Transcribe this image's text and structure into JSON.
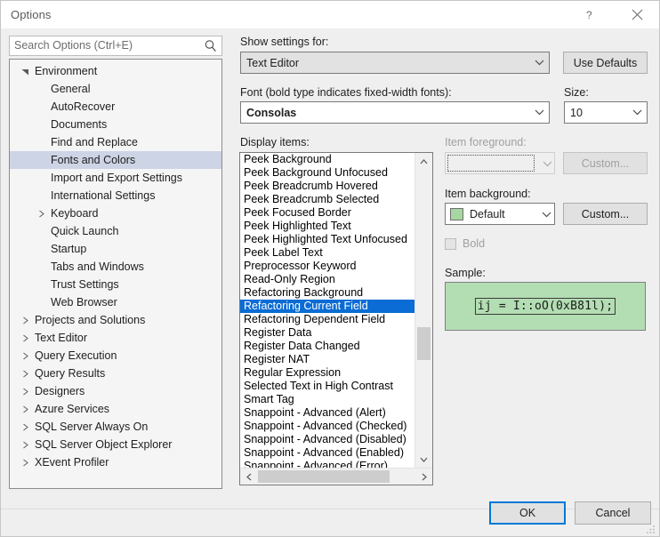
{
  "window": {
    "title": "Options",
    "help_icon": "question-mark-icon",
    "close_icon": "close-icon"
  },
  "search": {
    "placeholder": "Search Options (Ctrl+E)",
    "value": "",
    "icon": "search-icon"
  },
  "tree": {
    "items": [
      {
        "label": "Environment",
        "depth": 0,
        "glyph": "expanded",
        "selected": false
      },
      {
        "label": "General",
        "depth": 1,
        "glyph": "none",
        "selected": false
      },
      {
        "label": "AutoRecover",
        "depth": 1,
        "glyph": "none",
        "selected": false
      },
      {
        "label": "Documents",
        "depth": 1,
        "glyph": "none",
        "selected": false
      },
      {
        "label": "Find and Replace",
        "depth": 1,
        "glyph": "none",
        "selected": false
      },
      {
        "label": "Fonts and Colors",
        "depth": 1,
        "glyph": "none",
        "selected": true
      },
      {
        "label": "Import and Export Settings",
        "depth": 1,
        "glyph": "none",
        "selected": false
      },
      {
        "label": "International Settings",
        "depth": 1,
        "glyph": "none",
        "selected": false
      },
      {
        "label": "Keyboard",
        "depth": 1,
        "glyph": "collapsed",
        "selected": false
      },
      {
        "label": "Quick Launch",
        "depth": 1,
        "glyph": "none",
        "selected": false
      },
      {
        "label": "Startup",
        "depth": 1,
        "glyph": "none",
        "selected": false
      },
      {
        "label": "Tabs and Windows",
        "depth": 1,
        "glyph": "none",
        "selected": false
      },
      {
        "label": "Trust Settings",
        "depth": 1,
        "glyph": "none",
        "selected": false
      },
      {
        "label": "Web Browser",
        "depth": 1,
        "glyph": "none",
        "selected": false
      },
      {
        "label": "Projects and Solutions",
        "depth": 0,
        "glyph": "collapsed",
        "selected": false
      },
      {
        "label": "Text Editor",
        "depth": 0,
        "glyph": "collapsed",
        "selected": false
      },
      {
        "label": "Query Execution",
        "depth": 0,
        "glyph": "collapsed",
        "selected": false
      },
      {
        "label": "Query Results",
        "depth": 0,
        "glyph": "collapsed",
        "selected": false
      },
      {
        "label": "Designers",
        "depth": 0,
        "glyph": "collapsed",
        "selected": false
      },
      {
        "label": "Azure Services",
        "depth": 0,
        "glyph": "collapsed",
        "selected": false
      },
      {
        "label": "SQL Server Always On",
        "depth": 0,
        "glyph": "collapsed",
        "selected": false
      },
      {
        "label": "SQL Server Object Explorer",
        "depth": 0,
        "glyph": "collapsed",
        "selected": false
      },
      {
        "label": "XEvent Profiler",
        "depth": 0,
        "glyph": "collapsed",
        "selected": false
      }
    ]
  },
  "pane": {
    "show_settings_label": "Show settings for:",
    "show_settings_value": "Text Editor",
    "use_defaults_label": "Use Defaults",
    "font_label": "Font (bold type indicates fixed-width fonts):",
    "font_value": "Consolas",
    "size_label": "Size:",
    "size_value": "10",
    "display_items_label": "Display items:",
    "display_items": [
      {
        "label": "Peek Background",
        "selected": false
      },
      {
        "label": "Peek Background Unfocused",
        "selected": false
      },
      {
        "label": "Peek Breadcrumb Hovered",
        "selected": false
      },
      {
        "label": "Peek Breadcrumb Selected",
        "selected": false
      },
      {
        "label": "Peek Focused Border",
        "selected": false
      },
      {
        "label": "Peek Highlighted Text",
        "selected": false
      },
      {
        "label": "Peek Highlighted Text Unfocused",
        "selected": false
      },
      {
        "label": "Peek Label Text",
        "selected": false
      },
      {
        "label": "Preprocessor Keyword",
        "selected": false
      },
      {
        "label": "Read-Only Region",
        "selected": false
      },
      {
        "label": "Refactoring Background",
        "selected": false
      },
      {
        "label": "Refactoring Current Field",
        "selected": true
      },
      {
        "label": "Refactoring Dependent Field",
        "selected": false
      },
      {
        "label": "Register Data",
        "selected": false
      },
      {
        "label": "Register Data Changed",
        "selected": false
      },
      {
        "label": "Register NAT",
        "selected": false
      },
      {
        "label": "Regular Expression",
        "selected": false
      },
      {
        "label": "Selected Text in High Contrast",
        "selected": false
      },
      {
        "label": "Smart Tag",
        "selected": false
      },
      {
        "label": "Snappoint - Advanced (Alert)",
        "selected": false
      },
      {
        "label": "Snappoint - Advanced (Checked)",
        "selected": false
      },
      {
        "label": "Snappoint - Advanced (Disabled)",
        "selected": false
      },
      {
        "label": "Snappoint - Advanced (Enabled)",
        "selected": false
      },
      {
        "label": "Snappoint - Advanced (Error)",
        "selected": false
      }
    ],
    "item_foreground_label": "Item foreground:",
    "item_foreground_value": "",
    "item_foreground_custom_label": "Custom...",
    "item_background_label": "Item background:",
    "item_background_value": "Default",
    "item_background_swatch_color": "#a8d6a2",
    "item_background_custom_label": "Custom...",
    "bold_label": "Bold",
    "bold_checked": false,
    "sample_label": "Sample:",
    "sample_text": "ij = I::oO(0xB81l);",
    "sample_background_color": "#b3ddb3"
  },
  "footer": {
    "ok_label": "OK",
    "cancel_label": "Cancel"
  }
}
